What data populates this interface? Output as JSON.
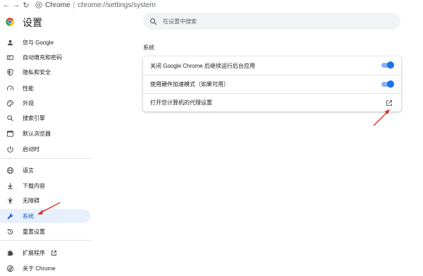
{
  "toolbar": {
    "site_label": "Chrome",
    "url_path": "chrome://settings/system"
  },
  "header": {
    "title": "设置",
    "search_placeholder": "在设置中搜索"
  },
  "sidebar": {
    "items": [
      {
        "label": "您与 Google",
        "icon": "person-icon"
      },
      {
        "label": "自动填充和密码",
        "icon": "autofill-icon"
      },
      {
        "label": "隐私和安全",
        "icon": "shield-icon"
      },
      {
        "label": "性能",
        "icon": "speedometer-icon"
      },
      {
        "label": "外观",
        "icon": "palette-icon"
      },
      {
        "label": "搜索引擎",
        "icon": "search-icon"
      },
      {
        "label": "默认浏览器",
        "icon": "browser-window-icon"
      },
      {
        "label": "启动时",
        "icon": "power-icon"
      },
      {
        "label": "语言",
        "icon": "globe-icon"
      },
      {
        "label": "下载内容",
        "icon": "download-icon"
      },
      {
        "label": "无障碍",
        "icon": "accessibility-icon"
      },
      {
        "label": "系统",
        "icon": "wrench-icon",
        "active": true
      },
      {
        "label": "重置设置",
        "icon": "history-reset-icon"
      },
      {
        "label": "扩展程序",
        "icon": "puzzle-icon",
        "external": true
      },
      {
        "label": "关于 Chrome",
        "icon": "chrome-logo-icon"
      }
    ]
  },
  "main": {
    "section_title": "系统",
    "rows": [
      {
        "label": "关闭 Google Chrome 后继续运行后台应用",
        "control": "toggle",
        "checked": true
      },
      {
        "label": "使用硬件加速模式（如果可用）",
        "control": "toggle",
        "checked": true
      },
      {
        "label": "打开您计算机的代理设置",
        "control": "external-link"
      }
    ]
  },
  "colors": {
    "accent": "#1a73e8",
    "active_bg": "#e8f0fe",
    "annotation_arrow": "#d93025"
  }
}
